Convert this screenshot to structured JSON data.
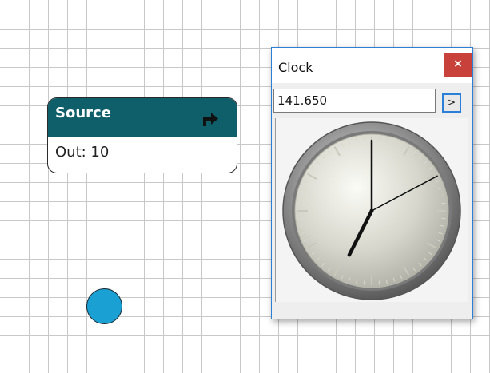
{
  "source_node": {
    "title": "Source",
    "output_label": "Out: 10",
    "header_color": "#0e5f6a",
    "icon": "turn-right-arrow-icon"
  },
  "circle": {
    "color": "#1aa0d2"
  },
  "clock_window": {
    "title": "Clock",
    "close_label": "×",
    "close_color": "#c9413b",
    "value": "141.650",
    "go_label": ">",
    "face": {
      "hour_hand_angle_deg": 207,
      "minute_hand_angle_deg": 0,
      "second_hand_angle_deg": 62
    }
  }
}
